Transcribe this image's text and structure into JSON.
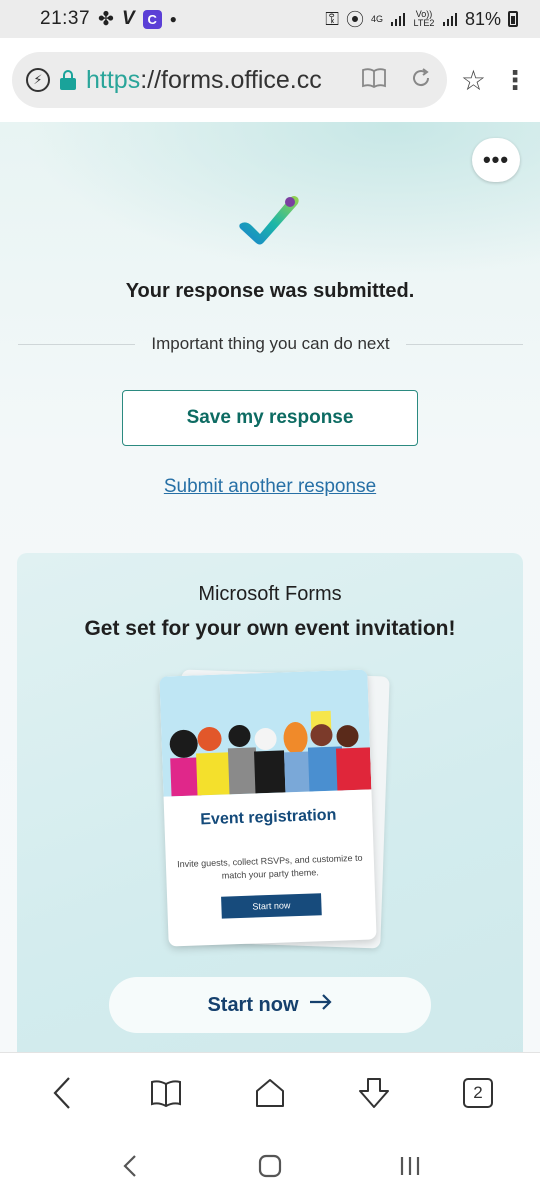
{
  "status_bar": {
    "time": "21:37",
    "network": "4G",
    "volte": "Vo)) LTE2",
    "battery": "81%"
  },
  "browser": {
    "url_scheme": "https",
    "url_rest": "://forms.office.cc",
    "icons": [
      "bolt-icon",
      "lock-icon",
      "reader-icon",
      "reload-icon",
      "star-icon",
      "menu-icon"
    ]
  },
  "main": {
    "submitted_title": "Your response was submitted.",
    "next_label": "Important thing you can do next",
    "save_button": "Save my response",
    "another_link": "Submit another response"
  },
  "promo": {
    "brand": "Microsoft Forms",
    "title": "Get set for your own event invitation!",
    "card_title": "Event registration",
    "card_desc": "Invite guests, collect RSVPs, and customize to match your party theme.",
    "card_button": "Start now",
    "start_button": "Start now"
  },
  "bottom_bar": {
    "tab_count": "2"
  },
  "colors": {
    "accent_teal": "#0d6b62",
    "link_blue": "#2770a6",
    "brand_navy": "#15406d"
  }
}
